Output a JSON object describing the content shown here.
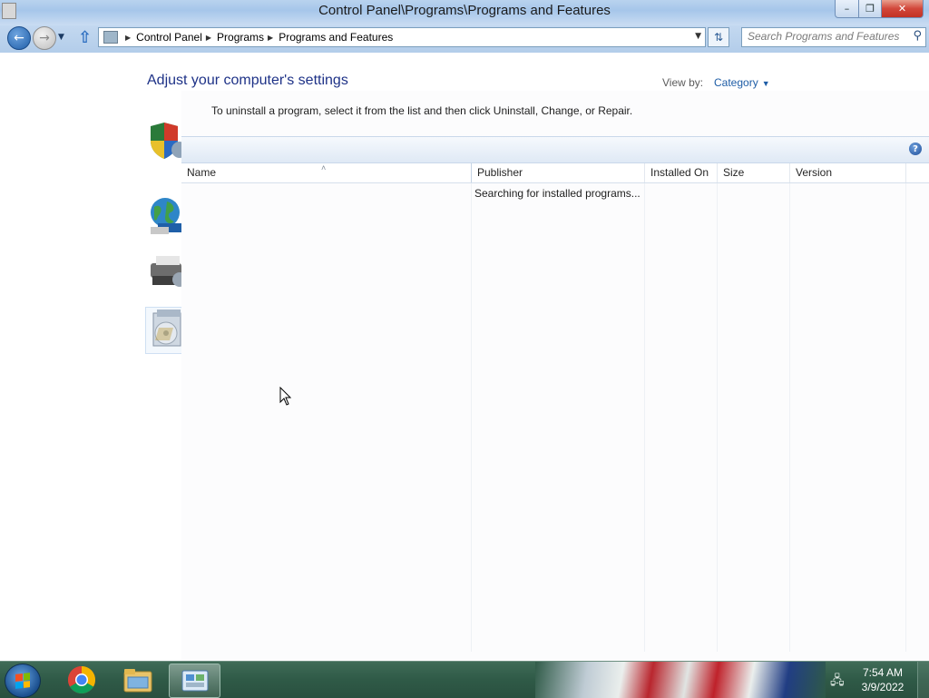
{
  "window": {
    "title": "Control Panel\\Programs\\Programs and Features",
    "buttons": {
      "minimize": "–",
      "maximize": "❐",
      "close": "✕"
    }
  },
  "navigation": {
    "breadcrumbs": [
      "Control Panel",
      "Programs",
      "Programs and Features"
    ],
    "search_placeholder": "Search Programs and Features"
  },
  "control_panel": {
    "heading": "Adjust your computer's settings",
    "view_by_label": "View by:",
    "view_by_value": "Category",
    "category_icons": [
      "shield-icon",
      "globe-network-icon",
      "printer-icon",
      "programs-icon"
    ]
  },
  "programs_and_features": {
    "instruction": "To uninstall a program, select it from the list and then click Uninstall, Change, or Repair.",
    "help_label": "?",
    "columns": [
      "Name",
      "Publisher",
      "Installed On",
      "Size",
      "Version"
    ],
    "sorted_column": "Name",
    "status_text": "Searching for installed programs..."
  },
  "taskbar": {
    "pinned": [
      "chrome-icon",
      "windows-explorer-icon",
      "control-panel-icon"
    ],
    "active": "control-panel-icon",
    "clock_time": "7:54 AM",
    "clock_date": "3/9/2022"
  },
  "colors": {
    "heading_blue": "#1e3287",
    "link_blue": "#1e5da6",
    "taskbar_green": "#2f5a47",
    "close_red": "#c23224"
  }
}
